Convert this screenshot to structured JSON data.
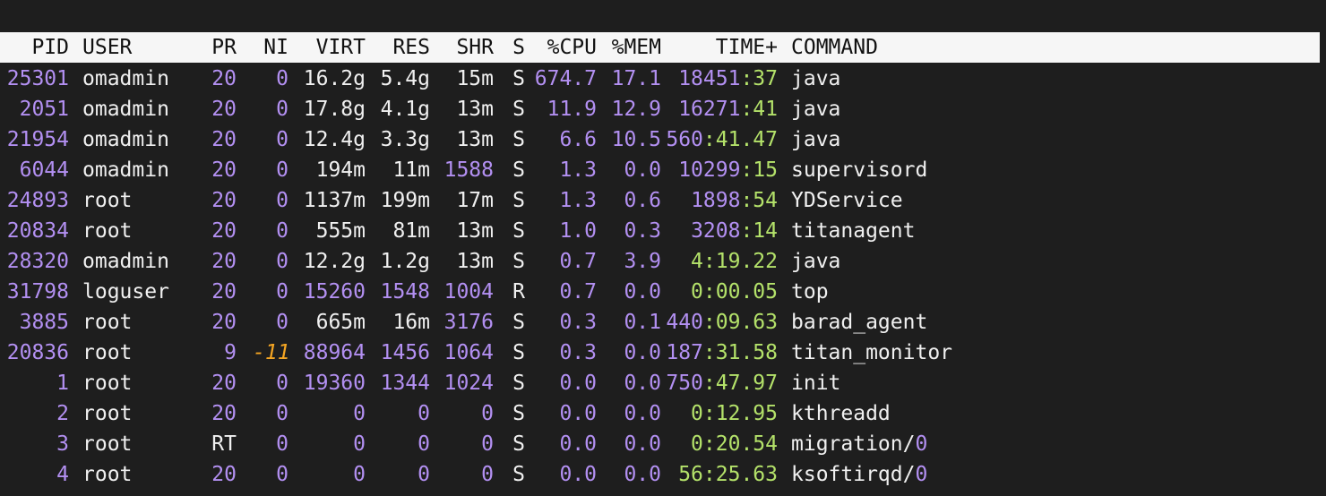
{
  "colors": {
    "background": "#1e1e1e",
    "header_bg": "#f6f6f6",
    "number": "#b390f2",
    "negative_nice": "#f5a623",
    "short_time": "#b4e26a",
    "text": "#f0f0f0"
  },
  "columns": [
    "PID",
    "USER",
    "PR",
    "NI",
    "VIRT",
    "RES",
    "SHR",
    "S",
    "%CPU",
    "%MEM",
    "TIME+",
    "COMMAND"
  ],
  "processes": [
    {
      "pid": "25301",
      "user": "omadmin",
      "pr": "20",
      "ni": "0",
      "virt": "16.2g",
      "res": "5.4g",
      "shr": "15m",
      "s": "S",
      "cpu": "674.7",
      "mem": "17.1",
      "time_major": "18451",
      "time_minor": ":37",
      "command": "java",
      "command_suffix": ""
    },
    {
      "pid": "2051",
      "user": "omadmin",
      "pr": "20",
      "ni": "0",
      "virt": "17.8g",
      "res": "4.1g",
      "shr": "13m",
      "s": "S",
      "cpu": "11.9",
      "mem": "12.9",
      "time_major": "16271",
      "time_minor": ":41",
      "command": "java",
      "command_suffix": ""
    },
    {
      "pid": "21954",
      "user": "omadmin",
      "pr": "20",
      "ni": "0",
      "virt": "12.4g",
      "res": "3.3g",
      "shr": "13m",
      "s": "S",
      "cpu": "6.6",
      "mem": "10.5",
      "time_major": "560",
      "time_minor": ":41.47",
      "command": "java",
      "command_suffix": ""
    },
    {
      "pid": "6044",
      "user": "omadmin",
      "pr": "20",
      "ni": "0",
      "virt": "194m",
      "res": "11m",
      "shr": "1588",
      "s": "S",
      "cpu": "1.3",
      "mem": "0.0",
      "time_major": "10299",
      "time_minor": ":15",
      "command": "supervisord",
      "command_suffix": ""
    },
    {
      "pid": "24893",
      "user": "root",
      "pr": "20",
      "ni": "0",
      "virt": "1137m",
      "res": "199m",
      "shr": "17m",
      "s": "S",
      "cpu": "1.3",
      "mem": "0.6",
      "time_major": "1898",
      "time_minor": ":54",
      "command": "YDService",
      "command_suffix": ""
    },
    {
      "pid": "20834",
      "user": "root",
      "pr": "20",
      "ni": "0",
      "virt": "555m",
      "res": "81m",
      "shr": "13m",
      "s": "S",
      "cpu": "1.0",
      "mem": "0.3",
      "time_major": "3208",
      "time_minor": ":14",
      "command": "titanagent",
      "command_suffix": ""
    },
    {
      "pid": "28320",
      "user": "omadmin",
      "pr": "20",
      "ni": "0",
      "virt": "12.2g",
      "res": "1.2g",
      "shr": "13m",
      "s": "S",
      "cpu": "0.7",
      "mem": "3.9",
      "time_major": "4",
      "time_minor": ":19.22",
      "command": "java",
      "command_suffix": ""
    },
    {
      "pid": "31798",
      "user": "loguser",
      "pr": "20",
      "ni": "0",
      "virt": "15260",
      "res": "1548",
      "shr": "1004",
      "s": "R",
      "cpu": "0.7",
      "mem": "0.0",
      "time_major": "0",
      "time_minor": ":00.05",
      "command": "top",
      "command_suffix": ""
    },
    {
      "pid": "3885",
      "user": "root",
      "pr": "20",
      "ni": "0",
      "virt": "665m",
      "res": "16m",
      "shr": "3176",
      "s": "S",
      "cpu": "0.3",
      "mem": "0.1",
      "time_major": "440",
      "time_minor": ":09.63",
      "command": "barad_agent",
      "command_suffix": ""
    },
    {
      "pid": "20836",
      "user": "root",
      "pr": "9",
      "ni": "-11",
      "virt": "88964",
      "res": "1456",
      "shr": "1064",
      "s": "S",
      "cpu": "0.3",
      "mem": "0.0",
      "time_major": "187",
      "time_minor": ":31.58",
      "command": "titan_monitor",
      "command_suffix": ""
    },
    {
      "pid": "1",
      "user": "root",
      "pr": "20",
      "ni": "0",
      "virt": "19360",
      "res": "1344",
      "shr": "1024",
      "s": "S",
      "cpu": "0.0",
      "mem": "0.0",
      "time_major": "750",
      "time_minor": ":47.97",
      "command": "init",
      "command_suffix": ""
    },
    {
      "pid": "2",
      "user": "root",
      "pr": "20",
      "ni": "0",
      "virt": "0",
      "res": "0",
      "shr": "0",
      "s": "S",
      "cpu": "0.0",
      "mem": "0.0",
      "time_major": "0",
      "time_minor": ":12.95",
      "command": "kthreadd",
      "command_suffix": ""
    },
    {
      "pid": "3",
      "user": "root",
      "pr": "RT",
      "ni": "0",
      "virt": "0",
      "res": "0",
      "shr": "0",
      "s": "S",
      "cpu": "0.0",
      "mem": "0.0",
      "time_major": "0",
      "time_minor": ":20.54",
      "command": "migration/",
      "command_suffix": "0"
    },
    {
      "pid": "4",
      "user": "root",
      "pr": "20",
      "ni": "0",
      "virt": "0",
      "res": "0",
      "shr": "0",
      "s": "S",
      "cpu": "0.0",
      "mem": "0.0",
      "time_major": "56",
      "time_minor": ":25.63",
      "command": "ksoftirqd/",
      "command_suffix": "0"
    }
  ]
}
